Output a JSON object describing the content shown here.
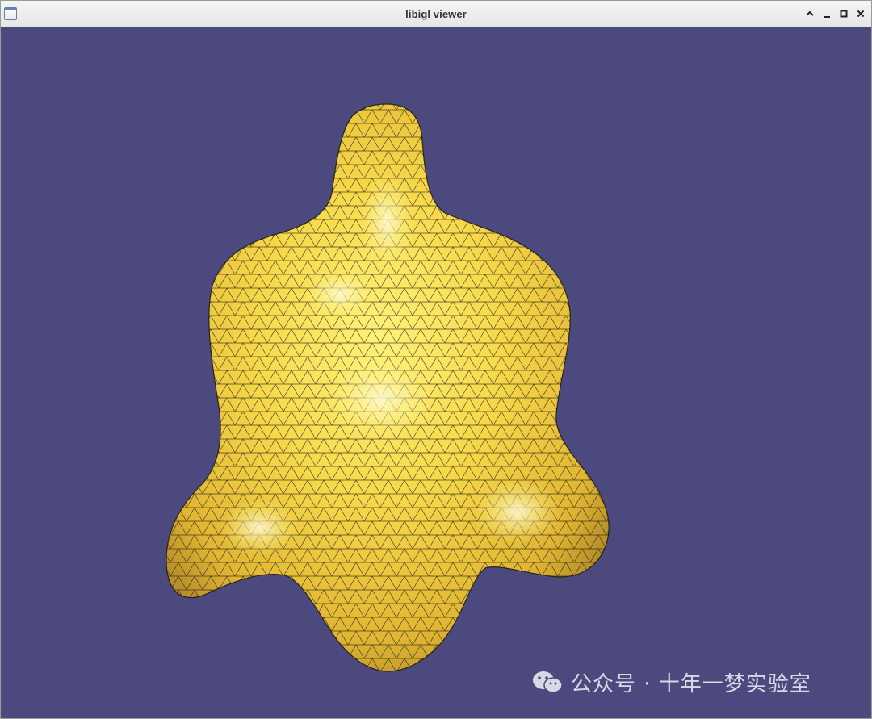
{
  "window": {
    "title": "libigl viewer",
    "icon": "window-app-icon"
  },
  "controls": {
    "minimize_icon": "chevron-up-icon",
    "iconify_icon": "minimize-icon",
    "maximize_icon": "maximize-icon",
    "close_icon": "close-icon"
  },
  "viewport": {
    "background_color": "#4b497e",
    "mesh_color": "#f7d84a",
    "wire_color": "#1a1a10",
    "mesh_description": "yellow triangulated blob with wireframe"
  },
  "watermark": {
    "icon": "wechat-icon",
    "text": "公众号 · 十年一梦实验室"
  }
}
